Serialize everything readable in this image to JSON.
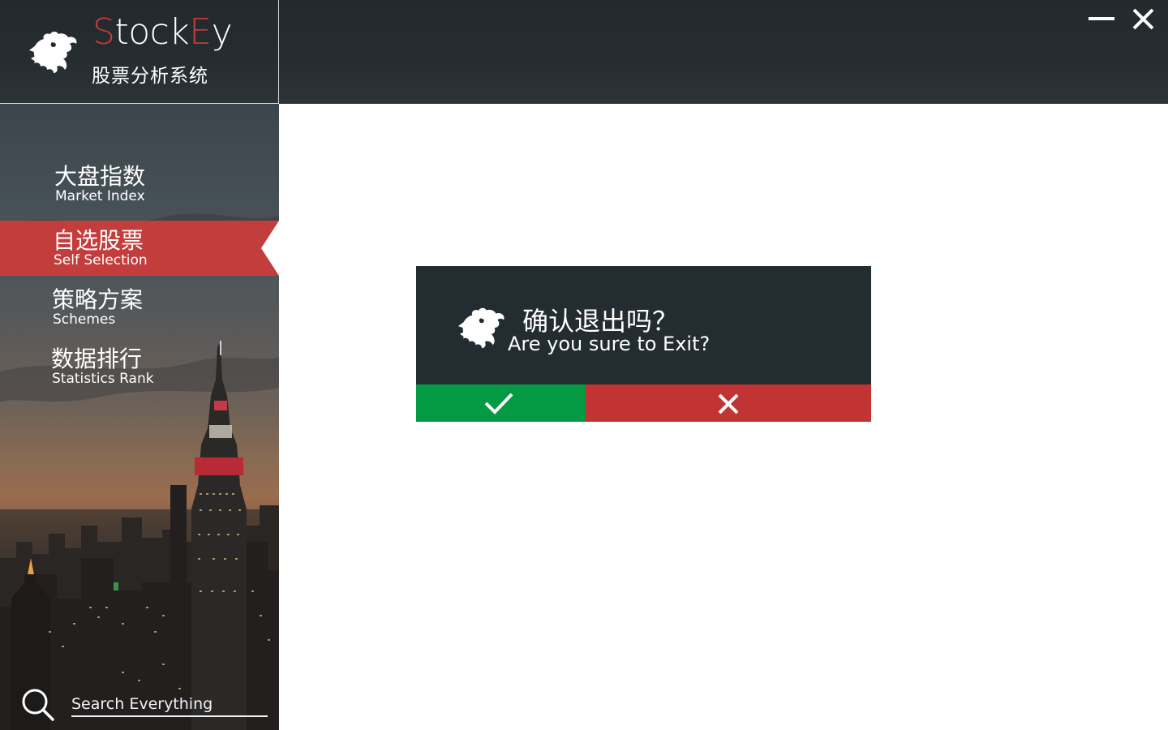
{
  "app": {
    "name_first_letter": "S",
    "name_middle": "tock",
    "name_accent_letter": "E",
    "name_last": "y",
    "subtitle": "股票分析系统",
    "logo_icon": "dragon-icon"
  },
  "window_controls": {
    "minimize_icon": "minimize-icon",
    "close_icon": "close-icon"
  },
  "sidebar": {
    "items": [
      {
        "zh": "大盘指数",
        "en": "Market Index",
        "active": false
      },
      {
        "zh": "自选股票",
        "en": "Self Selection",
        "active": true
      },
      {
        "zh": "策略方案",
        "en": "Schemes",
        "active": false
      },
      {
        "zh": "数据排行",
        "en": "Statistics Rank",
        "active": false
      }
    ],
    "search": {
      "placeholder": "Search Everything",
      "icon": "search-icon"
    }
  },
  "dialog": {
    "title_zh": "确认退出吗？",
    "title_en": "Are you sure to Exit?",
    "confirm_icon": "check-icon",
    "cancel_icon": "close-icon"
  },
  "colors": {
    "accent_red": "#c33d3d",
    "confirm_green": "#049a44",
    "cancel_red": "#c23434",
    "dark": "#232c30"
  }
}
